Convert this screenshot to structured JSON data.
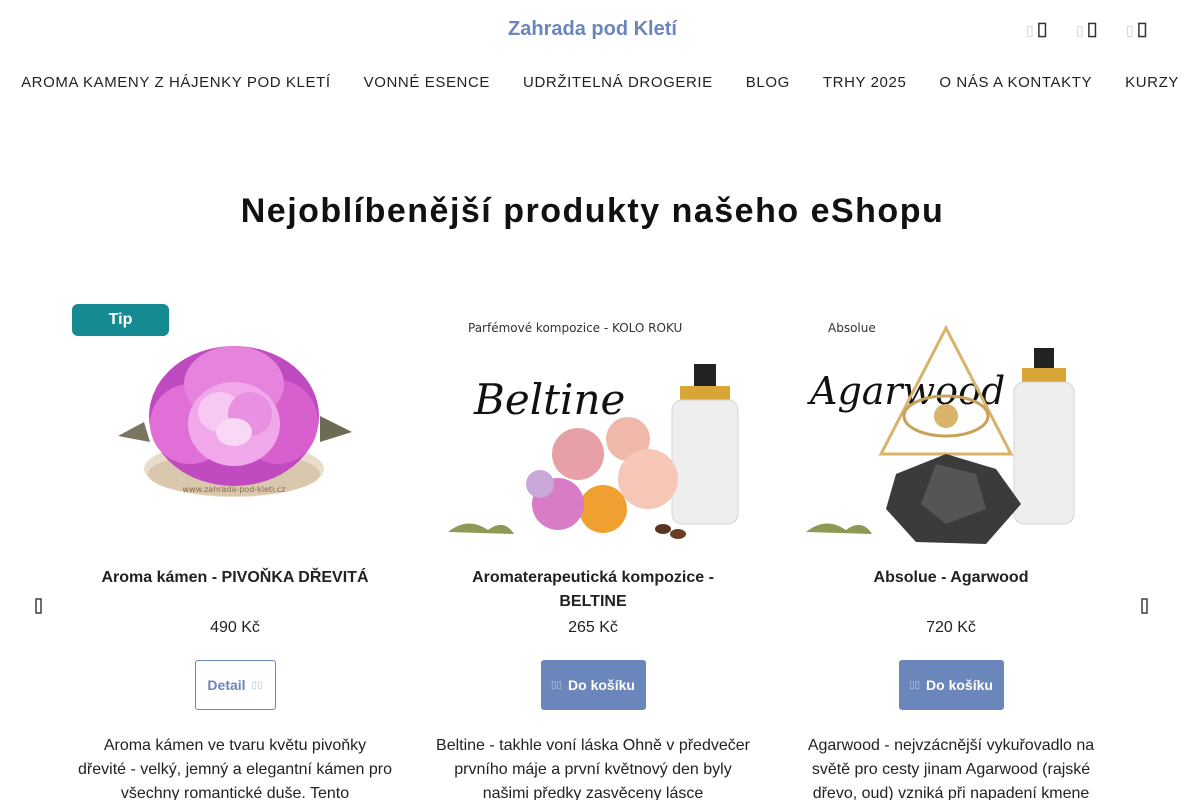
{
  "header": {
    "logo": "Zahrada pod Kletí",
    "icons": [
      "search-icon",
      "user-icon",
      "cart-icon"
    ]
  },
  "nav": {
    "items": [
      {
        "label": "AROMA KAMENY Z HÁJENKY POD KLETÍ"
      },
      {
        "label": "VONNÉ ESENCE"
      },
      {
        "label": "UDRŽITELNÁ DROGERIE"
      },
      {
        "label": "BLOG"
      },
      {
        "label": "TRHY 2025"
      },
      {
        "label": "O NÁS A KONTAKTY"
      },
      {
        "label": "KURZY"
      }
    ]
  },
  "section": {
    "title": "Nejoblíbenější produkty našeho eShopu"
  },
  "products": [
    {
      "badge": "Tip",
      "name": "Aroma kámen - PIVOŇKA DŘEVITÁ",
      "price": "490 Kč",
      "button": "Detail",
      "description": "Aroma kámen ve tvaru květu pivoňky dřevité - velký, jemný a elegantní kámen pro všechny romantické duše. Tento",
      "image_text": "www.zahrada-pod-kleti.cz"
    },
    {
      "name": "Aromaterapeutická kompozice - BELTINE",
      "price": "265 Kč",
      "button": "Do košíku",
      "description": "Beltine - takhle voní láska Ohně v předvečer prvního máje a první květnový den byly našimi předky zasvěceny lásce",
      "image_caption": "Parfémové kompozice - KOLO ROKU",
      "image_script": "Beltine"
    },
    {
      "name": "Absolue - Agarwood",
      "price": "720 Kč",
      "button": "Do košíku",
      "description": "Agarwood - nejvzácnější vykuřovadlo na světě pro cesty jinam Agarwood (rajské dřevo, oud) vzniká při napadení kmene",
      "image_caption": "Absolue",
      "image_script": "Agarwood"
    }
  ],
  "colors": {
    "brand": "#6b86bb",
    "badge": "#158a93"
  }
}
